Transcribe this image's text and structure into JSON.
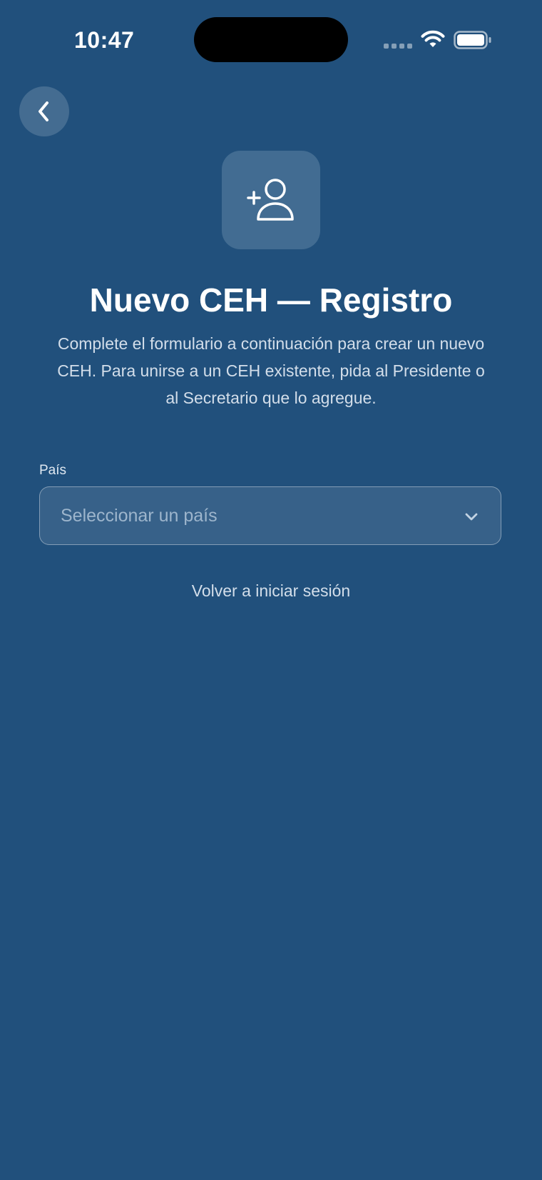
{
  "status_bar": {
    "time": "10:47"
  },
  "nav": {
    "back_icon": "chevron-left-icon"
  },
  "hero": {
    "icon": "user-plus-icon"
  },
  "page": {
    "title": "Nuevo CEH — Registro",
    "description": "Complete el formulario a continuación para crear un nuevo CEH. Para unirse a un CEH existente, pida al Presidente o al Secretario que lo agregue."
  },
  "form": {
    "country": {
      "label": "País",
      "placeholder": "Seleccionar un país",
      "value": ""
    }
  },
  "links": {
    "back_to_login": "Volver a iniciar sesión"
  },
  "colors": {
    "background": "#21507c",
    "icon_box": "#426c92",
    "text_primary": "#ffffff",
    "text_secondary": "#d3deea"
  }
}
